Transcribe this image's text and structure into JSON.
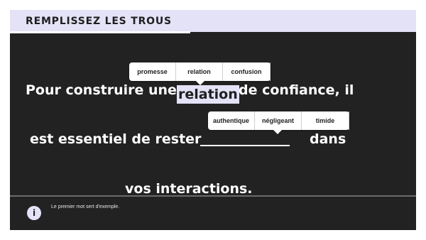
{
  "header": {
    "title": "REMPLISSEZ LES TROUS"
  },
  "sentence": {
    "line1_before": "Pour construire une",
    "line1_filled": "relation",
    "line1_after": "de confiance, il",
    "line2_before": "est essentiel de rester",
    "line2_after": "dans",
    "line3": "vos interactions."
  },
  "options1": [
    "promesse",
    "relation",
    "confusion"
  ],
  "options2": [
    "authentique",
    "négligeant",
    "timide"
  ],
  "footer": {
    "hint": "Le premier mot sert d'exemple.",
    "info_icon": "i"
  },
  "colors": {
    "accent": "#e4e2f7",
    "background": "#222222",
    "text": "#ffffff"
  }
}
